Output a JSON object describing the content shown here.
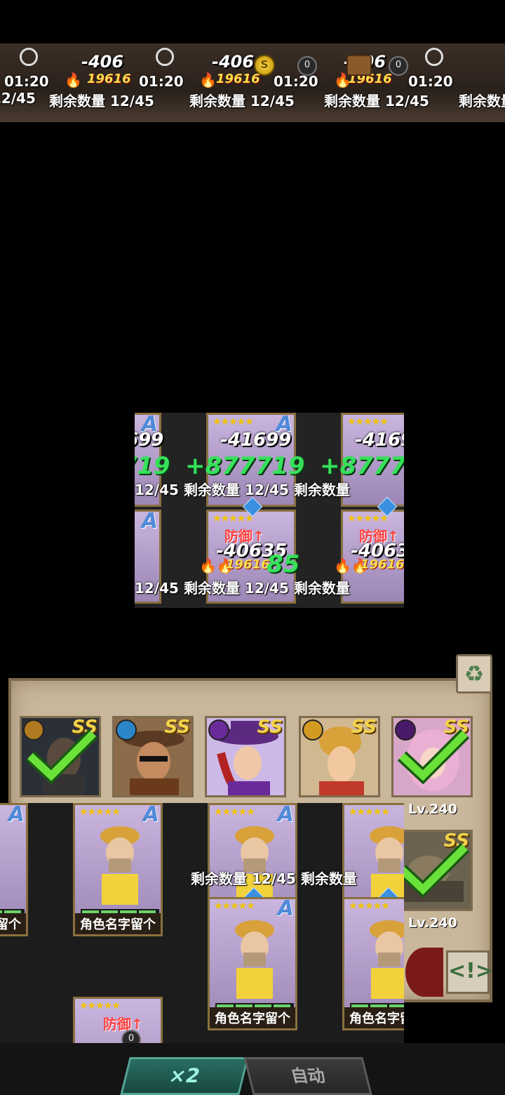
{
  "hud": {
    "timer": "01:20",
    "count_prefix": "12/45",
    "count_label": "剩余数量",
    "damage": "-406",
    "heal_small": "19616",
    "coin_symbol": "S",
    "zero": "0"
  },
  "battle": {
    "damage_big": "-41699",
    "heal_big": "+877719",
    "damage_mid": "-40635",
    "heal_tail": "19616",
    "green_tail": "85",
    "count_prefix": "12/45",
    "count_label": "剩余数量",
    "rank": "A",
    "def_tag": "防御↑"
  },
  "selection": {
    "rank": "SS",
    "heroes": [
      {
        "name": "warrior",
        "selected": true
      },
      {
        "name": "gunslinger",
        "selected": false
      },
      {
        "name": "magician",
        "selected": false
      },
      {
        "name": "pilot",
        "selected": false
      },
      {
        "name": "witch",
        "selected": true
      },
      {
        "name": "rider",
        "selected": true
      }
    ],
    "level_1": "Lv.240",
    "level_2": "Lv.240"
  },
  "slots": {
    "name_label": "角色名字留个",
    "rank": "A",
    "count_prefix": "12/45",
    "count_label": "剩余数量",
    "hp_fraction": 1.0
  },
  "controls": {
    "speed_label": "×2",
    "auto_label": "自动",
    "recycle_icon": "recycle-icon",
    "alert_icon": "alert-icon"
  },
  "colors": {
    "heal_green": "#35e05a",
    "damage_white": "#ffffff",
    "def_red": "#ff4040",
    "rank_blue": "#4f8ad8",
    "rank_gold": "#f3d34a"
  }
}
